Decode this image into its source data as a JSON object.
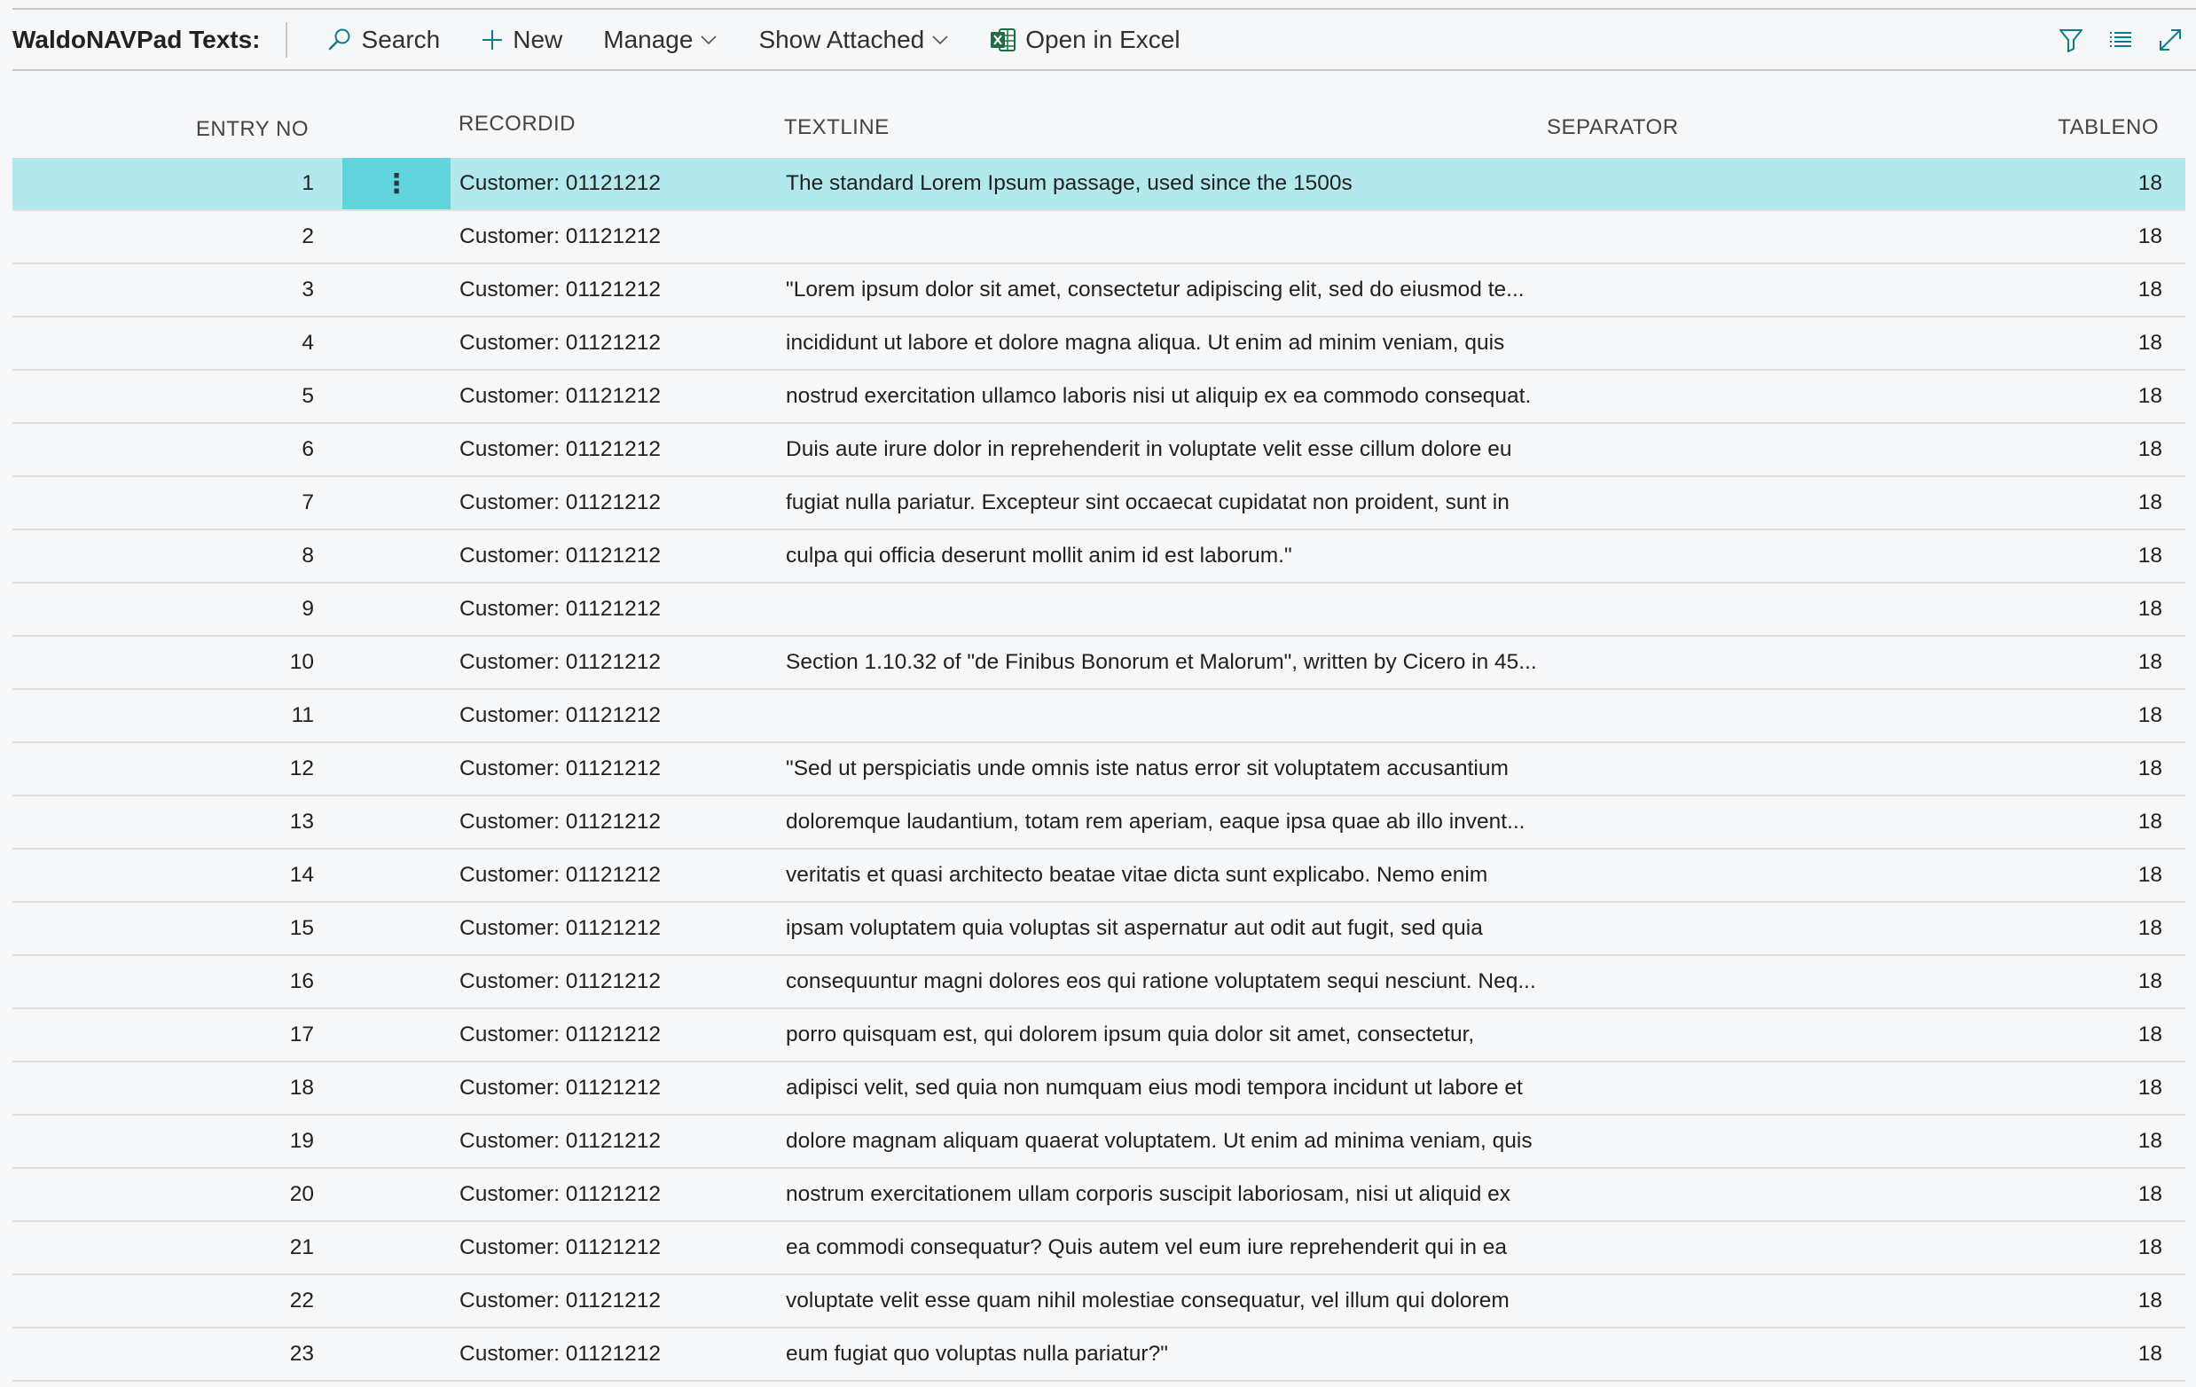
{
  "toolbar": {
    "title": "WaldoNAVPad Texts:",
    "search_label": "Search",
    "new_label": "New",
    "manage_label": "Manage",
    "show_attached_label": "Show Attached",
    "open_excel_label": "Open in Excel"
  },
  "columns": {
    "entry_no": "ENTRY NO",
    "record_id": "RECORDID",
    "text_line": "TEXTLINE",
    "separator": "SEPARATOR",
    "table_no": "TABLENO"
  },
  "colors": {
    "selected_row": "#b3e9ec",
    "row_menu": "#62d4dc",
    "accent": "#0f7b89",
    "excel_green": "#1d6f42"
  },
  "rows": [
    {
      "entry": "1",
      "record": "Customer: 01121212",
      "text": "The standard Lorem Ipsum passage, used since the 1500s",
      "table": "18",
      "selected": true
    },
    {
      "entry": "2",
      "record": "Customer: 01121212",
      "text": "",
      "table": "18"
    },
    {
      "entry": "3",
      "record": "Customer: 01121212",
      "text": "\"Lorem ipsum dolor sit amet, consectetur adipiscing elit, sed do eiusmod te...",
      "table": "18"
    },
    {
      "entry": "4",
      "record": "Customer: 01121212",
      "text": "incididunt ut labore et dolore magna aliqua. Ut enim ad minim veniam, quis",
      "table": "18"
    },
    {
      "entry": "5",
      "record": "Customer: 01121212",
      "text": "nostrud exercitation ullamco laboris nisi ut aliquip ex ea commodo consequat.",
      "table": "18"
    },
    {
      "entry": "6",
      "record": "Customer: 01121212",
      "text": "Duis aute irure dolor in reprehenderit in voluptate velit esse cillum dolore eu",
      "table": "18"
    },
    {
      "entry": "7",
      "record": "Customer: 01121212",
      "text": "fugiat nulla pariatur. Excepteur sint occaecat cupidatat non proident, sunt in",
      "table": "18"
    },
    {
      "entry": "8",
      "record": "Customer: 01121212",
      "text": "culpa qui officia deserunt mollit anim id est laborum.\"",
      "table": "18"
    },
    {
      "entry": "9",
      "record": "Customer: 01121212",
      "text": "",
      "table": "18"
    },
    {
      "entry": "10",
      "record": "Customer: 01121212",
      "text": "Section 1.10.32 of \"de Finibus Bonorum et Malorum\", written by Cicero in 45...",
      "table": "18"
    },
    {
      "entry": "11",
      "record": "Customer: 01121212",
      "text": "",
      "table": "18"
    },
    {
      "entry": "12",
      "record": "Customer: 01121212",
      "text": "\"Sed ut perspiciatis unde omnis iste natus error sit voluptatem accusantium",
      "table": "18"
    },
    {
      "entry": "13",
      "record": "Customer: 01121212",
      "text": "doloremque laudantium, totam rem aperiam, eaque ipsa quae ab illo invent...",
      "table": "18"
    },
    {
      "entry": "14",
      "record": "Customer: 01121212",
      "text": "veritatis et quasi architecto beatae vitae dicta sunt explicabo. Nemo enim",
      "table": "18"
    },
    {
      "entry": "15",
      "record": "Customer: 01121212",
      "text": "ipsam voluptatem quia voluptas sit aspernatur aut odit aut fugit, sed quia",
      "table": "18"
    },
    {
      "entry": "16",
      "record": "Customer: 01121212",
      "text": "consequuntur magni dolores eos qui ratione voluptatem sequi nesciunt. Neq...",
      "table": "18"
    },
    {
      "entry": "17",
      "record": "Customer: 01121212",
      "text": "porro quisquam est, qui dolorem ipsum quia dolor sit amet, consectetur,",
      "table": "18"
    },
    {
      "entry": "18",
      "record": "Customer: 01121212",
      "text": "adipisci velit, sed quia non numquam eius modi tempora incidunt ut labore et",
      "table": "18"
    },
    {
      "entry": "19",
      "record": "Customer: 01121212",
      "text": "dolore magnam aliquam quaerat voluptatem. Ut enim ad minima veniam, quis",
      "table": "18"
    },
    {
      "entry": "20",
      "record": "Customer: 01121212",
      "text": "nostrum exercitationem ullam corporis suscipit laboriosam, nisi ut aliquid ex",
      "table": "18"
    },
    {
      "entry": "21",
      "record": "Customer: 01121212",
      "text": "ea commodi consequatur? Quis autem vel eum iure reprehenderit qui in ea",
      "table": "18"
    },
    {
      "entry": "22",
      "record": "Customer: 01121212",
      "text": "voluptate velit esse quam nihil molestiae consequatur, vel illum qui dolorem",
      "table": "18"
    },
    {
      "entry": "23",
      "record": "Customer: 01121212",
      "text": "eum fugiat quo voluptas nulla pariatur?\"",
      "table": "18"
    }
  ]
}
